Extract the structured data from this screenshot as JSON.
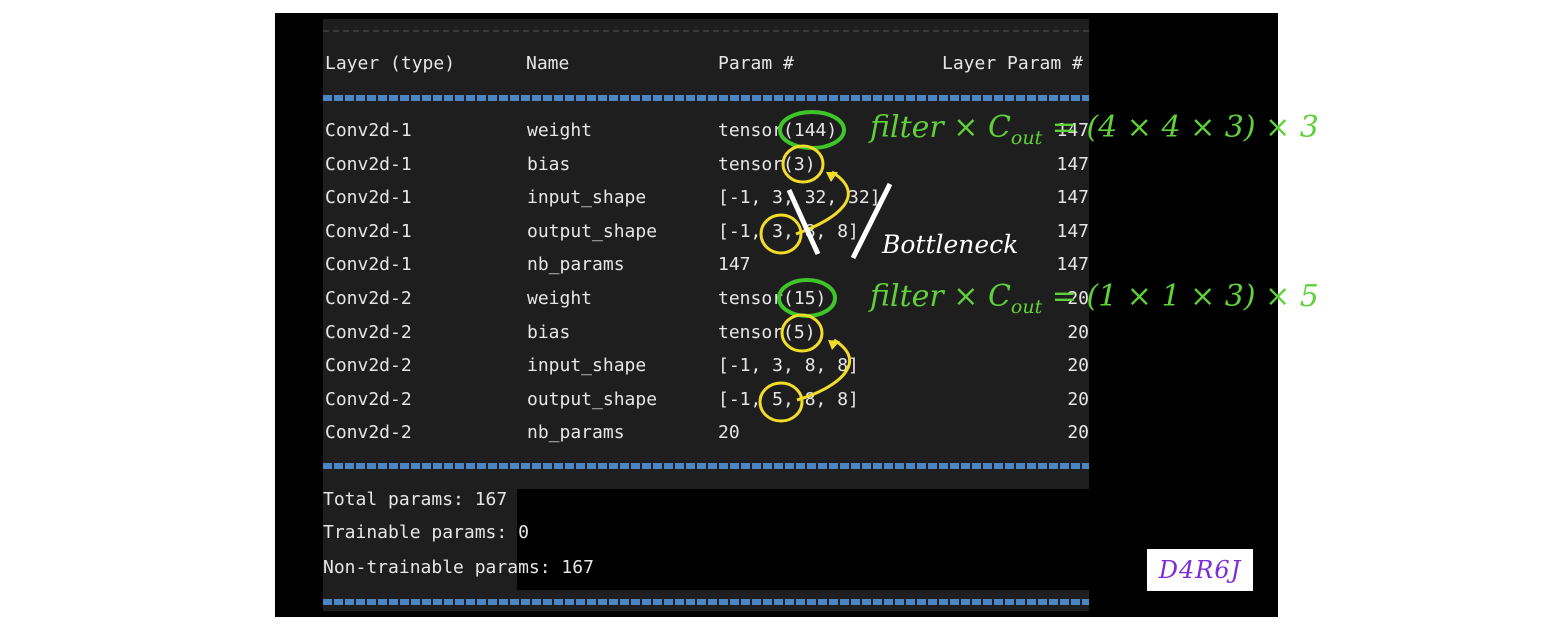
{
  "columns": {
    "layer_type": "Layer (type)",
    "name": "Name",
    "param": "Param #",
    "layer_param": "Layer Param #"
  },
  "rows": [
    {
      "layer": "Conv2d-1",
      "name": "weight",
      "param": "tensor(144)",
      "layer_param": "147"
    },
    {
      "layer": "Conv2d-1",
      "name": "bias",
      "param": "tensor(3)",
      "layer_param": "147"
    },
    {
      "layer": "Conv2d-1",
      "name": "input_shape",
      "param": "[-1, 3, 32, 32]",
      "layer_param": "147"
    },
    {
      "layer": "Conv2d-1",
      "name": "output_shape",
      "param": "[-1, 3, 8, 8]",
      "layer_param": "147"
    },
    {
      "layer": "Conv2d-1",
      "name": "nb_params",
      "param": "147",
      "layer_param": "147"
    },
    {
      "layer": "Conv2d-2",
      "name": "weight",
      "param": "tensor(15)",
      "layer_param": "20"
    },
    {
      "layer": "Conv2d-2",
      "name": "bias",
      "param": "tensor(5)",
      "layer_param": "20"
    },
    {
      "layer": "Conv2d-2",
      "name": "input_shape",
      "param": "[-1, 3, 8, 8]",
      "layer_param": "20"
    },
    {
      "layer": "Conv2d-2",
      "name": "output_shape",
      "param": "[-1, 5, 8, 8]",
      "layer_param": "20"
    },
    {
      "layer": "Conv2d-2",
      "name": "nb_params",
      "param": "20",
      "layer_param": "20"
    }
  ],
  "summary": {
    "total": "Total params: 167",
    "trainable": "Trainable params: 0",
    "non_trainable": "Non-trainable params: 167"
  },
  "annotations": {
    "formula1_prefix": "filter × C",
    "formula1_sub": "out",
    "formula1_suffix": " = (4 × 4 × 3) × 3",
    "formula2_prefix": "filter × C",
    "formula2_sub": "out",
    "formula2_suffix": " = (1 × 1 × 3) × 5",
    "bottleneck": "Bottleneck",
    "signature": "D4R6J"
  },
  "colors": {
    "terminal_bg": "#1e1e1e",
    "text": "#e6e6e6",
    "rule_blue": "#4a86c5",
    "circle_green": "#3fc42a",
    "circle_yellow": "#f2dc2a",
    "formula_green": "#5fd13a",
    "signature_purple": "#7b2cd8"
  }
}
